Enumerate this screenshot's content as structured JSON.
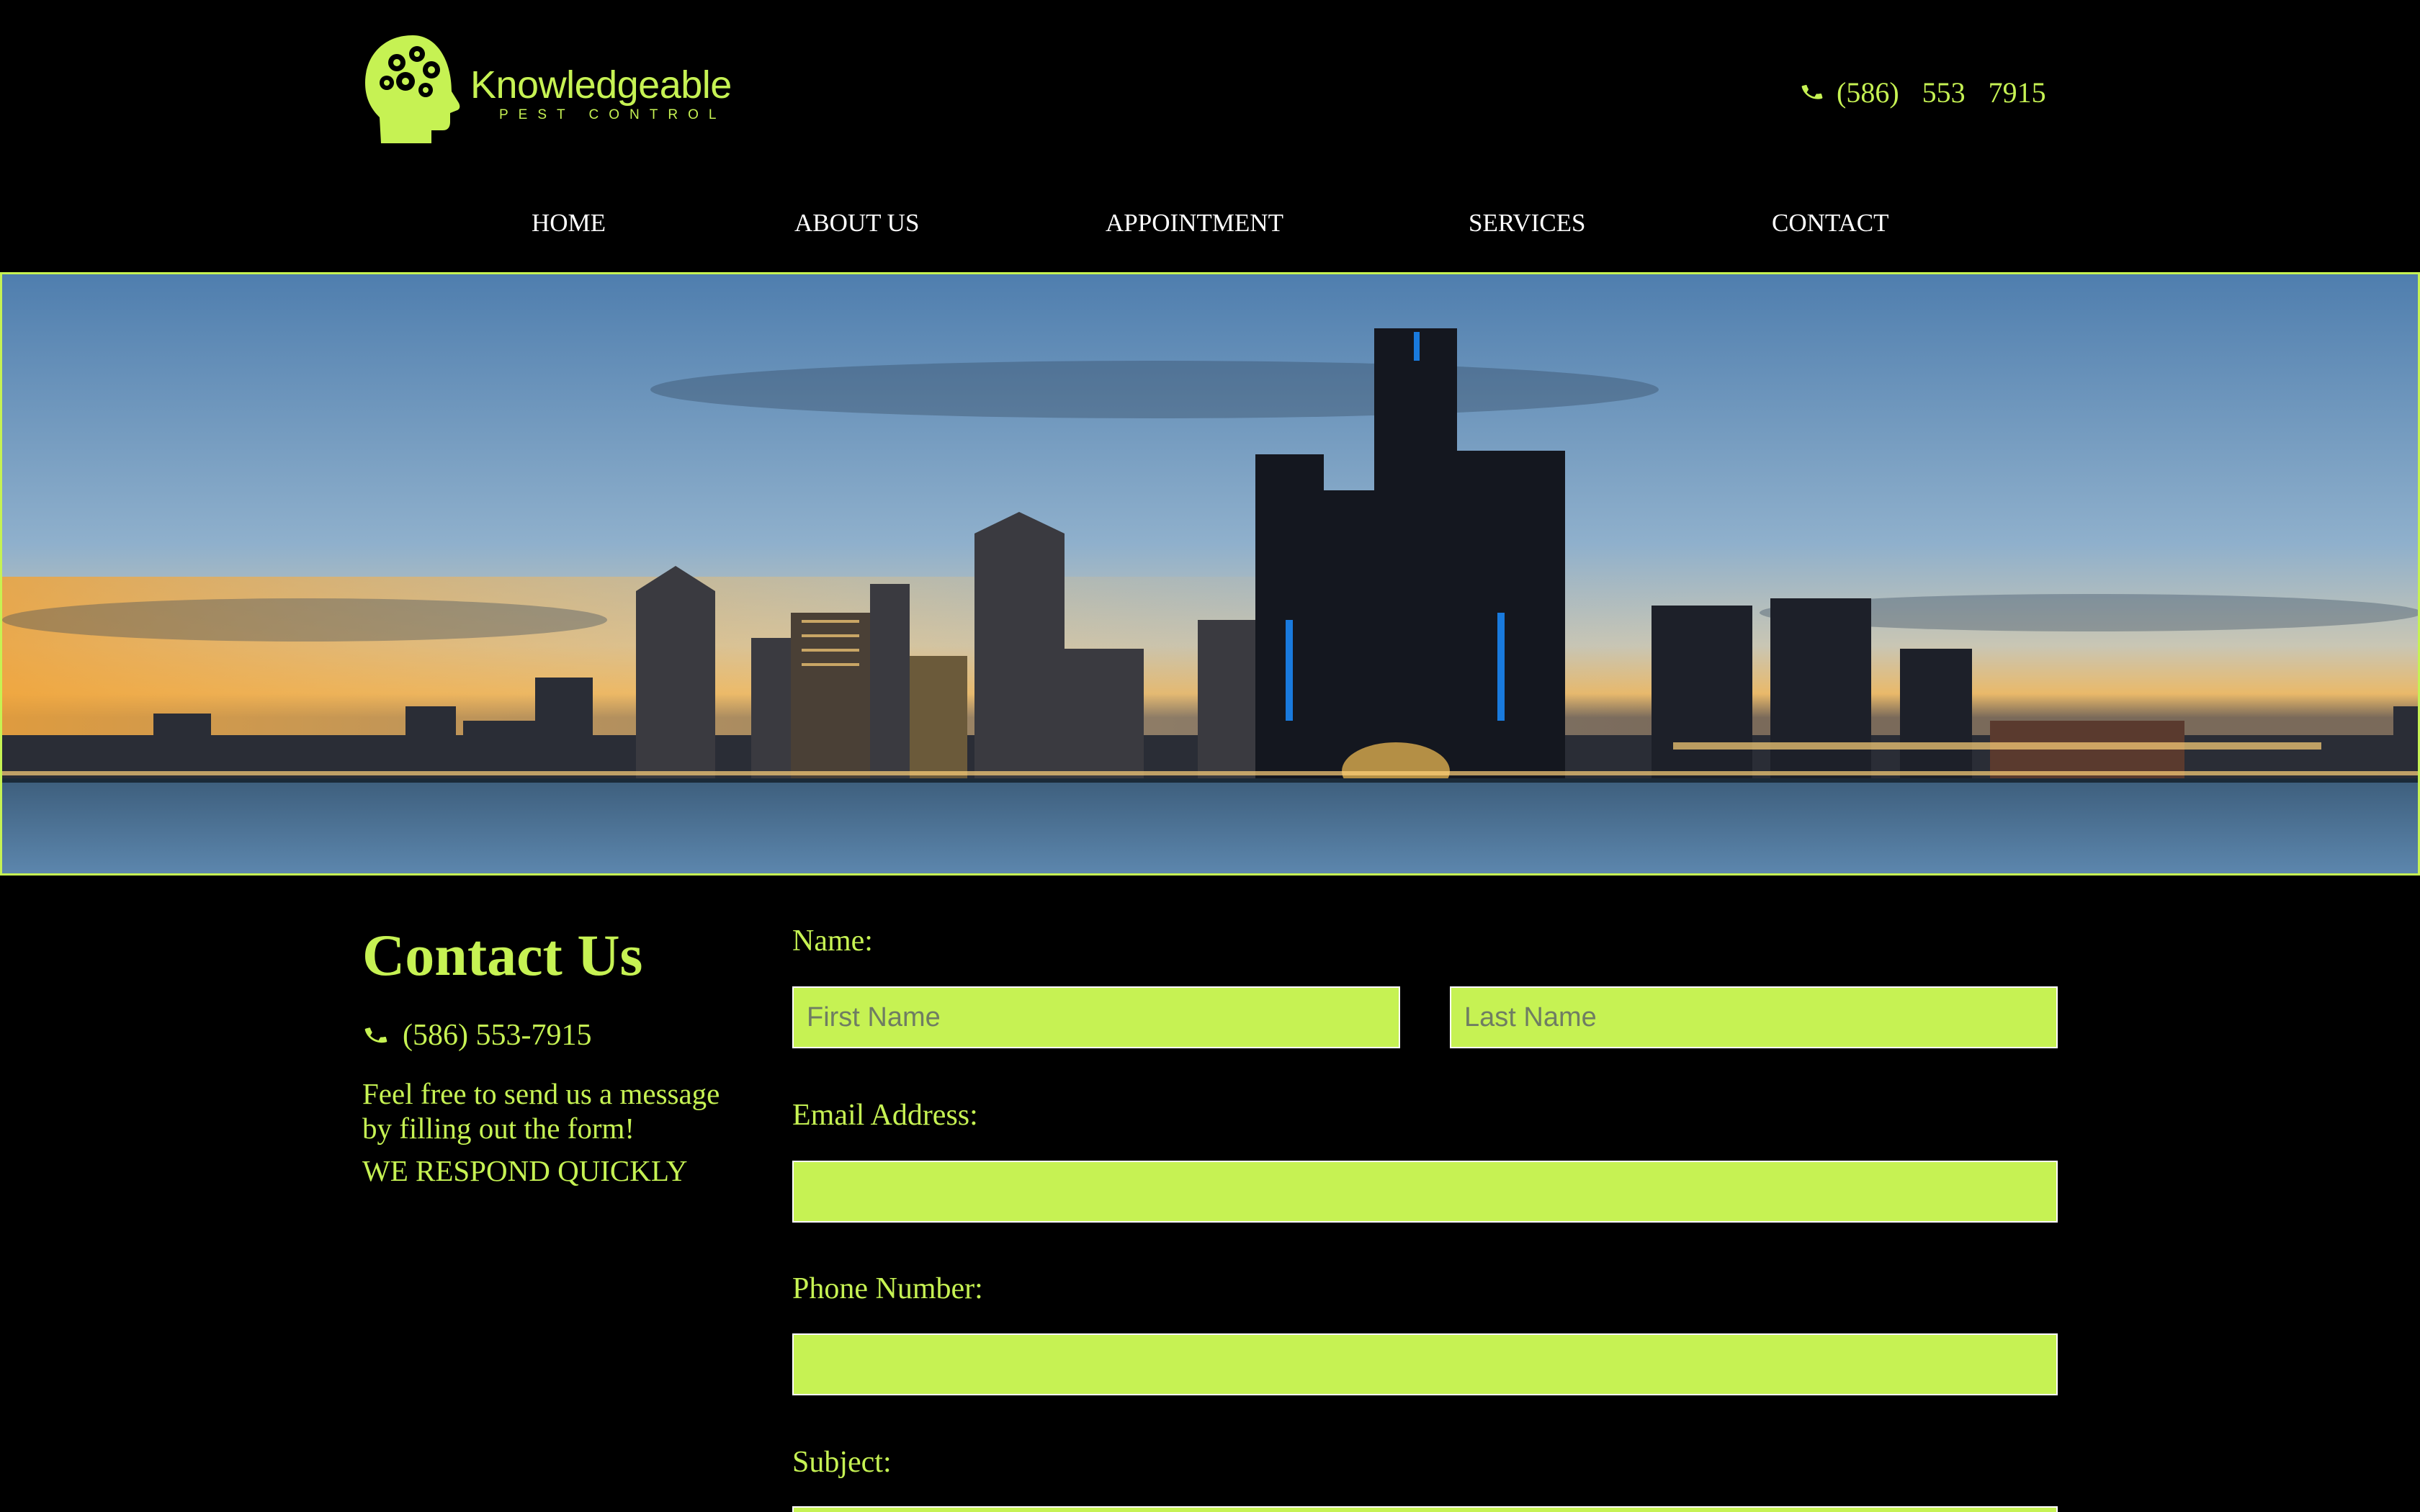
{
  "brand": {
    "name": "Knowledgeable",
    "tagline": "PEST CONTROL"
  },
  "header": {
    "phone": "(586)  553  7915",
    "phone_icon": "phone-icon"
  },
  "nav": {
    "items": [
      {
        "label": "HOME"
      },
      {
        "label": "ABOUT US"
      },
      {
        "label": "APPOINTMENT"
      },
      {
        "label": "SERVICES"
      },
      {
        "label": "CONTACT"
      }
    ]
  },
  "hero": {
    "image": "city-skyline-at-dusk"
  },
  "contact": {
    "title": "Contact Us",
    "phone": "(586) 553-7915",
    "message": "Feel free to send us a message by filling out the form!",
    "respond": "WE RESPOND QUICKLY"
  },
  "form": {
    "name_label": "Name:",
    "first_name_placeholder": "First Name",
    "last_name_placeholder": "Last Name",
    "email_label": "Email Address:",
    "phone_label": "Phone Number:",
    "subject_label": "Subject:"
  },
  "colors": {
    "accent": "#c6f253",
    "background": "#000000",
    "nav_text": "#ffffff"
  }
}
